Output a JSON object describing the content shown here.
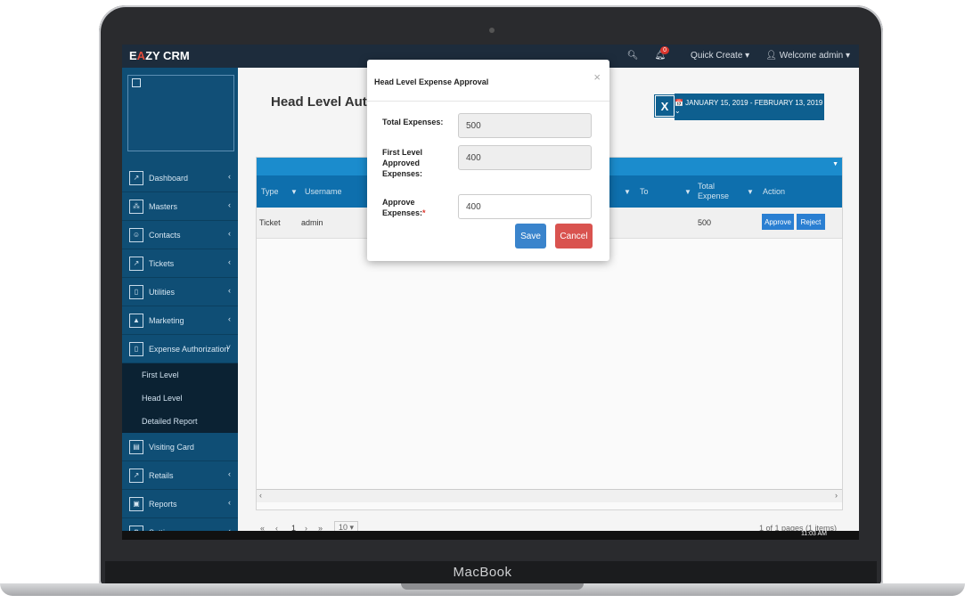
{
  "device": {
    "brand": "MacBook"
  },
  "app": {
    "logo_prefix": "E",
    "logo_accent": "A",
    "logo_suffix": "ZY CRM",
    "notification_count": "0",
    "quick_create": "Quick Create ▾",
    "welcome": "Welcome admin ▾"
  },
  "sidebar": {
    "items": [
      {
        "label": "Dashboard"
      },
      {
        "label": "Masters"
      },
      {
        "label": "Contacts"
      },
      {
        "label": "Tickets"
      },
      {
        "label": "Utilities"
      },
      {
        "label": "Marketing"
      },
      {
        "label": "Expense Authorization"
      }
    ],
    "sub_items": [
      {
        "label": "First Level"
      },
      {
        "label": "Head Level"
      },
      {
        "label": "Detailed Report"
      }
    ],
    "items_after": [
      {
        "label": "Visiting Card"
      },
      {
        "label": "Retails"
      },
      {
        "label": "Reports"
      },
      {
        "label": "Settings"
      }
    ]
  },
  "page": {
    "title": "Head Level Author",
    "export_label": "X",
    "date_range": "📅 JANUARY 15, 2019 - FEBRUARY 13, 2019 ⌄"
  },
  "grid": {
    "columns": [
      "Type",
      "Username",
      "To",
      "Total Expense",
      "Action"
    ],
    "rows": [
      {
        "type": "Ticket",
        "username": "admin",
        "total": "500",
        "approve": "Approve",
        "reject": "Reject"
      }
    ],
    "pager_page": "1",
    "pager_size": "10 ▾",
    "pager_info": "1 of 1 pages (1 items)",
    "time": "11:03 AM"
  },
  "modal": {
    "title": "Head Level Expense Approval",
    "close": "×",
    "total_label": "Total Expenses:",
    "total_value": "500",
    "first_level_label": "First Level Approved Expenses:",
    "first_level_value": "400",
    "approve_label": "Approve Expenses:",
    "approve_required": "*",
    "approve_value": "400",
    "save": "Save",
    "cancel": "Cancel"
  },
  "colors": {
    "sidebar": "#0f4e75",
    "header": "#1d2c3c",
    "save": "#3a84cc",
    "cancel": "#d9534f"
  }
}
